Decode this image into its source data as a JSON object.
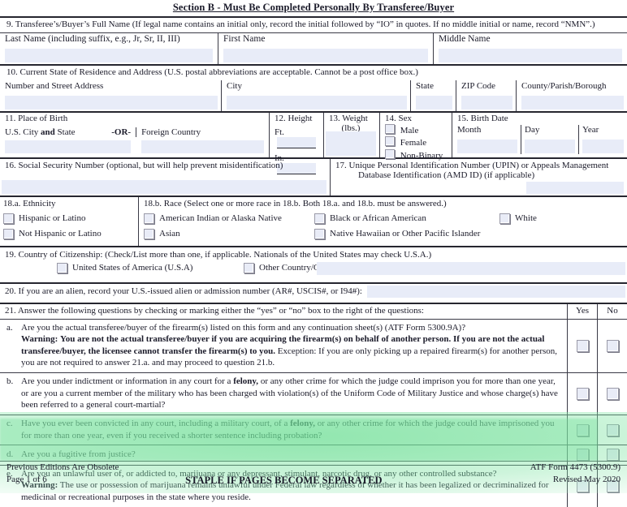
{
  "section": {
    "header": "Section B - Must Be Completed Personally By Transferee/Buyer"
  },
  "q9": {
    "prompt": "9.  Transferee’s/Buyer’s Full Name (If legal name contains an initial only, record the initial followed by “IO” in quotes.  If no middle initial or name, record “NMN”.)",
    "last_label": "Last Name (including suffix, e.g., Jr, Sr, II, III)",
    "last_value": "",
    "first_label": "First Name",
    "first_value": "",
    "middle_label": "Middle Name",
    "middle_value": ""
  },
  "q10": {
    "prompt": "10.   Current State of Residence and Address  (U.S. postal abbreviations are acceptable.  Cannot be a post office box.)",
    "street_label": "Number and Street Address",
    "street_value": "",
    "city_label": "City",
    "city_value": "",
    "state_label": "State",
    "state_value": "",
    "zip_label": "ZIP Code",
    "zip_value": "",
    "county_label": "County/Parish/Borough",
    "county_value": ""
  },
  "q11": {
    "prompt": "11.  Place of Birth",
    "us_label_a": "U.S. City",
    "us_label_and": "and",
    "us_label_b": "State",
    "or_label": "-OR-",
    "us_value": "",
    "foreign_label": "Foreign Country",
    "foreign_value": ""
  },
  "q12": {
    "prompt": "12.  Height",
    "ft_label": "Ft.",
    "ft_value": "",
    "in_label": "In.",
    "in_value": ""
  },
  "q13": {
    "prompt": "13.  Weight",
    "unit": "(lbs.)",
    "value": ""
  },
  "q14": {
    "prompt": "14.  Sex",
    "options": [
      "Male",
      "Female",
      "Non-Binary"
    ]
  },
  "q15": {
    "prompt": "15.  Birth Date",
    "month_label": "Month",
    "month_value": "",
    "day_label": "Day",
    "day_value": "",
    "year_label": "Year",
    "year_value": ""
  },
  "q16": {
    "prompt": "16.  Social Security Number (optional, but will help prevent misidentification)",
    "value": ""
  },
  "q17": {
    "prompt_line1": "17. Unique Personal Identification Number (UPIN) or Appeals Management",
    "prompt_line2": "Database Identification (AMD ID) (if applicable)",
    "value": ""
  },
  "q18a": {
    "prompt": "18.a.  Ethnicity",
    "options": [
      "Hispanic or Latino",
      "Not Hispanic or Latino"
    ]
  },
  "q18b": {
    "prompt": "18.b. Race (Select one or more race in 18.b.  Both 18.a. and 18.b. must be answered.)",
    "options": [
      "American Indian or Alaska Native",
      "Black or African American",
      "White",
      "Asian",
      "Native Hawaiian or Other Pacific Islander"
    ]
  },
  "q19": {
    "prompt": "19.  Country of Citizenship:  (Check/List more than one, if applicable.  Nationals of the United States may check U.S.A.)",
    "option_usa": "United States of America (U.S.A)",
    "option_other": "Other Country/Countries (Specify):",
    "other_value": ""
  },
  "q20": {
    "prompt": "20.  If you are an alien, record your U.S.-issued alien or admission number (AR#, USCIS#, or I94#):",
    "value": ""
  },
  "q21": {
    "prompt": "21.  Answer the following questions by checking or marking either the “yes” or “no” box to the right of the questions:",
    "yes_label": "Yes",
    "no_label": "No",
    "items": [
      {
        "letter": "a.",
        "line1_plain": "Are you the actual transferee/buyer of the firearm(s) listed on this form and any continuation sheet(s) (ATF Form 5300.9A)?",
        "warning_label": "Warning:",
        "warning_bold": "You are not the actual transferee/buyer if you are acquiring the firearm(s) on behalf of another person.  If you are not the actual transferee/buyer, the licensee cannot transfer the firearm(s) to you.",
        "tail_plain": "Exception: If you are only picking up a repaired firearm(s) for another person, you are not required to answer 21.a. and may proceed to question 21.b.",
        "highlighted": false
      },
      {
        "letter": "b.",
        "text_pre": "Are you under indictment or information in any court for a ",
        "text_bold": "felony,",
        "text_post": " or any other crime for which the judge could imprison you for more than one year, or are you a current member of the military who has been charged with violation(s) of the Uniform Code of Military Justice and whose charge(s) have been referred to a general court-martial?",
        "highlighted": false
      },
      {
        "letter": "c.",
        "text_pre": "Have you ever been convicted in any court, including a military court, of a ",
        "text_bold": "felony,",
        "text_post": " or any other crime for which the judge could have imprisoned you for more than one year, even if you received a shorter sentence including probation?",
        "highlighted": false
      },
      {
        "letter": "d.",
        "text_pre": "Are you a fugitive from justice?",
        "text_bold": "",
        "text_post": "",
        "highlighted": false
      },
      {
        "letter": "e.",
        "line1_plain": "Are you an unlawful user of, or addicted to, marijuana or any depressant, stimulant, narcotic drug, or any other controlled substance?",
        "warning_label": "Warning:",
        "warning_plain": "The use or possession of marijuana remains unlawful under Federal law regardless of whether it has been legalized or decriminalized for medicinal or recreational purposes in the state where you reside.",
        "highlighted": true
      }
    ]
  },
  "footer": {
    "previous_editions": "Previous Editions Are Obsolete",
    "page": "Page 1 of 6",
    "staple": "STAPLE IF PAGES BECOME SEPARATED",
    "form_id": "ATF Form 4473 (5300.9)",
    "revised": "Revised May 2020"
  },
  "colors": {
    "field_fill": "#e8ecf8",
    "highlight": "#bff0cd",
    "rule": "#3a3a46"
  }
}
